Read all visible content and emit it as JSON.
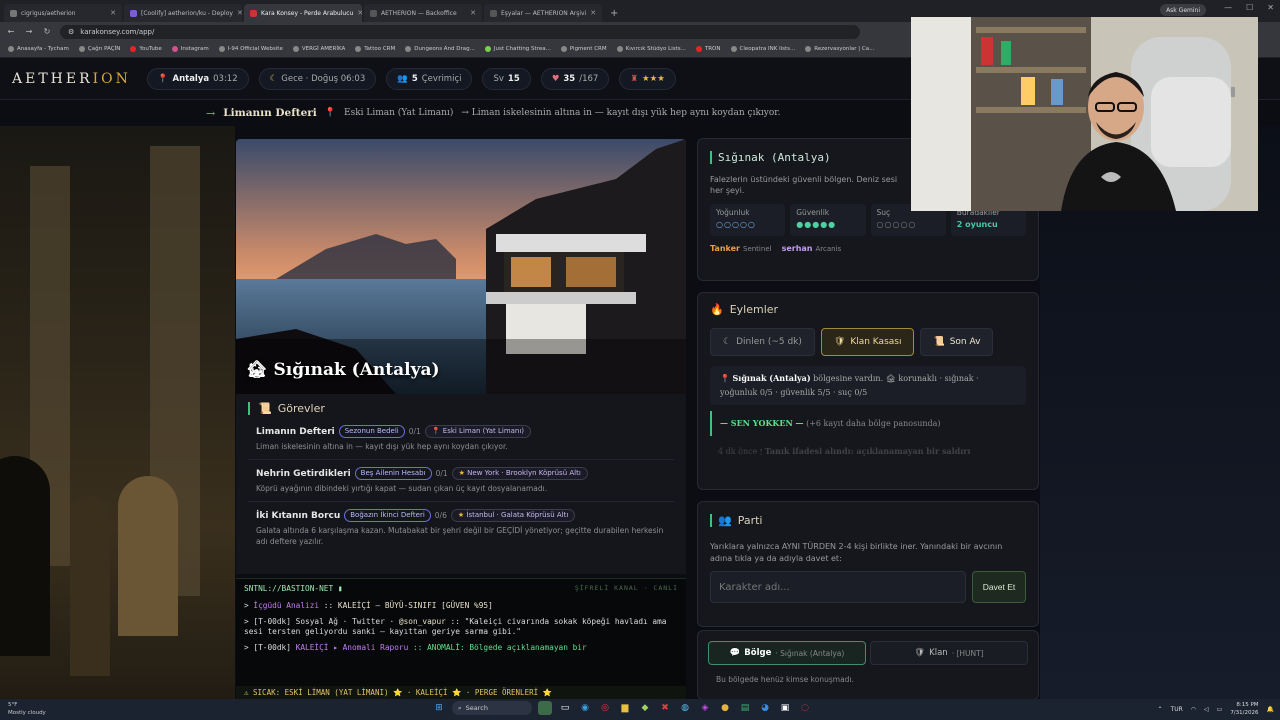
{
  "browser": {
    "tabs": [
      {
        "label": "cigrigus/aetherion",
        "active": false
      },
      {
        "label": "[Coolify] aetherion/ku - Deploy",
        "active": false
      },
      {
        "label": "Kara Konsey - Perde Arabulucu",
        "active": true
      },
      {
        "label": "AETHERION — Backoffice",
        "active": false
      },
      {
        "label": "Eşyalar — AETHERION Arşivi",
        "active": false
      }
    ],
    "profile_label": "Ask Gemini",
    "url": "karakonsey.com/app/",
    "bookmarks": [
      "Anasayfa - Tycham",
      "Çağrı PAÇİN",
      "YouTube",
      "Instagram",
      "I-94 Official Website",
      "VERGİ AMERİKA",
      "Tattoo CRM",
      "Dungeons And Drag...",
      "Just Chatting Strea...",
      "Pigment CRM",
      "Kıvırcık Stüdyo Lists...",
      "TRON",
      "Cleopatra INK lists...",
      "Rezervasyonlar | Ca..."
    ]
  },
  "header": {
    "logo_a": "AETHER",
    "logo_b": "ION",
    "location": "Antalya",
    "location_time": "03:12",
    "night_label": "Gece · Doğuş 06:03",
    "online_count": "5",
    "online_label": "Çevrimiçi",
    "level_label": "Sv",
    "level_value": "15",
    "hp_value": "35",
    "hp_max": "/167",
    "rating_stars": "★★★"
  },
  "subheader": {
    "title": "Limanın Defteri",
    "location_text": "Eski Liman (Yat Limanı)",
    "desc": "→ Liman iskelesinin altına in — kayıt dışı yük hep aynı koydan çıkıyor."
  },
  "hero": {
    "title": "Sığınak (Antalya)",
    "icon": "🏚"
  },
  "goals": {
    "heading": "Görevler",
    "items": [
      {
        "title": "Limanın Defteri",
        "badge": "Sezonun Bedeli",
        "progress": "0/1",
        "location_icon": "📍",
        "location": "Eski Liman (Yat Limanı)",
        "desc": "Liman iskelesinin altına in — kayıt dışı yük hep aynı koydan çıkıyor."
      },
      {
        "title": "Nehrin Getirdikleri",
        "badge": "Beş Ailenin Hesabı",
        "progress": "0/1",
        "location_icon": "★",
        "location": "New York · Brooklyn Köprüsü Altı",
        "desc": "Köprü ayağının dibindeki yırtığı kapat — sudan çıkan üç kayıt dosyalanamadı."
      },
      {
        "title": "İki Kıtanın Borcu",
        "badge": "Boğazın İkinci Defteri",
        "progress": "0/6",
        "location_icon": "★",
        "location": "İstanbul · Galata Köprüsü Altı",
        "desc": "Galata altında 6 karşılaşma kazan. Mutabakat bir şehri değil bir GEÇİDİ yönetiyor; geçitte durabilen herkesin adı deftere yazılır."
      }
    ]
  },
  "terminal": {
    "title": "SNTNL://BASTION-NET ▮",
    "status": "ŞİFRELİ KANAL · CANLI",
    "line1_prefix": "> ",
    "line1_name": "İçgüdü Analizi",
    "line1_text": " :: KALEİÇİ — BÜYÜ-SINIFI [GÜVEN %95]",
    "line2_prefix": "> [T-00dk] Sosyal Ağ · Twitter · ",
    "line2_handle": "@son_vapur",
    "line2_text": " :: \"Kaleiçi civarında sokak köpeği havladı ama sesi tersten geliyordu sanki — kayıttan geriye sarma gibi.\"",
    "line3_prefix": "> [T-00dk] ",
    "line3_name": "KALEİÇİ ▸ Anomali Raporu",
    "line3_text": " :: ANOMALİ: Bölgede açıklanamayan bir",
    "hot_line": "⚠ SICAK: ESKİ LİMAN (YAT LİMANI) ⭐ · KALEİÇİ ⭐ · PERGE ÖRENLERİ ⭐"
  },
  "shelter": {
    "title": "Sığınak (Antalya)",
    "desc": "Falezlerin üstündeki güvenli bölgen. Deniz sesi her şeyi.",
    "stats": [
      {
        "label": "Yoğunluk",
        "value": "○○○○○"
      },
      {
        "label": "Güvenlik",
        "value": "●●●●●"
      },
      {
        "label": "Suç",
        "value": "○○○○○"
      },
      {
        "label": "Buradakiler",
        "value": "2 oyuncu"
      }
    ],
    "roles": [
      {
        "name": "Tanker",
        "cls": "Sentinel"
      },
      {
        "name": "serhan",
        "cls": "Arcanis"
      }
    ]
  },
  "actions": {
    "title": "Eylemler",
    "buttons": {
      "rest": "Dinlen (~5 dk)",
      "vault": "Klan Kasası",
      "hunt": "Son Av"
    },
    "log": {
      "a_bold": "Sığınak (Antalya)",
      "a_text1": " bölgesine vardın.",
      "a_text2": " 🏚 korunaklı · sığınak · yoğunluk 0/5 · güvenlik 5/5 · suç 0/5",
      "b_bold": "— SEN YOKKEN —",
      "b_text": " (+6 kayıt daha bölge panosunda)",
      "c_time": "4 dk önce",
      "c_text": "Tanık ifadesi alındı: açıklanamayan bir saldırı"
    }
  },
  "party": {
    "title": "Parti",
    "desc": "Yarıklara yalnızca AYNI TÜRDEN 2-4 kişi birlikte iner. Yanındaki bir avcının adına tıkla ya da adıyla davet et:",
    "input_placeholder": "Karakter adı...",
    "invite_label": "Davet Et"
  },
  "chat": {
    "tab_region": "Bölge",
    "tab_region_sub": "· Sığınak (Antalya)",
    "tab_clan": "Klan",
    "tab_clan_sub": "· [HUNT]",
    "empty_text": "Bu bölgede henüz kimse konuşmadı."
  },
  "taskbar": {
    "weather_temp": "5°F",
    "weather_desc": "Mostly cloudy",
    "search_label": "Search",
    "lang": "TUR",
    "time": "8:15 PM",
    "date": "7/31/2026"
  },
  "colors": {
    "accent_green": "#3ec07e",
    "gold": "#d9a441",
    "danger": "#e05555"
  }
}
